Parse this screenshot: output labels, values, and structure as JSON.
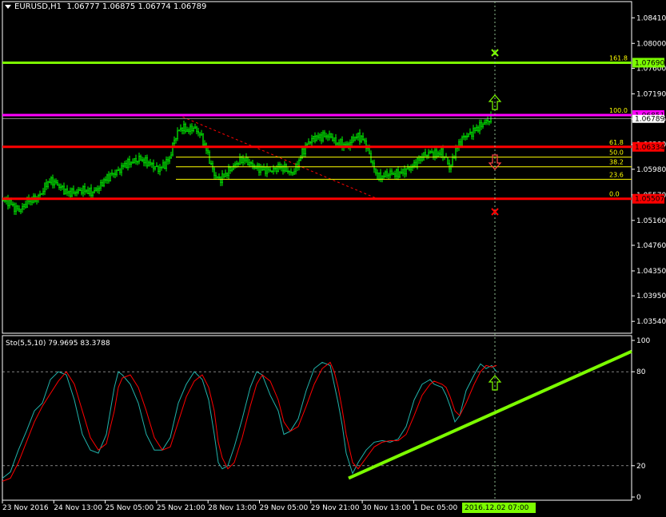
{
  "header": {
    "symbol": "EURUSD,H1",
    "ohlc": "1.06777 1.06875 1.06774 1.06789"
  },
  "colors": {
    "background": "#000000",
    "candle": "#00ff00",
    "fib": "#ffff00",
    "level_green": "#7cfc00",
    "level_magenta": "#ff00ff",
    "level_red": "#ff0000",
    "stoch_main": "#20b2aa",
    "stoch_signal": "#ff0000",
    "axis": "#ffffff"
  },
  "chart_data": [
    {
      "type": "candlestick",
      "title": "EURUSD,H1",
      "ohlc_label": "1.06777 1.06875 1.06774 1.06789",
      "ylim": [
        1.0335,
        1.0867
      ],
      "y_ticks": [
        "1.08410",
        "1.08000",
        "1.07600",
        "1.07190",
        "1.06785",
        "1.06380",
        "1.05980",
        "1.05570",
        "1.05160",
        "1.04760",
        "1.04350",
        "1.03950",
        "1.03540"
      ],
      "x_ticks": [
        "23 Nov 2016",
        "24 Nov 13:00",
        "25 Nov 05:00",
        "25 Nov 21:00",
        "28 Nov 13:00",
        "29 Nov 05:00",
        "29 Nov 21:00",
        "30 Nov 13:00",
        "1 Dec 05:00"
      ],
      "cursor_time": "2016.12.02 07:00",
      "price_path": [
        [
          0,
          1.0552
        ],
        [
          5,
          1.0548
        ],
        [
          12,
          1.0545
        ],
        [
          18,
          1.0536
        ],
        [
          25,
          1.0532
        ],
        [
          35,
          1.0548
        ],
        [
          45,
          1.055
        ],
        [
          52,
          1.056
        ],
        [
          58,
          1.0575
        ],
        [
          65,
          1.058
        ],
        [
          75,
          1.057
        ],
        [
          85,
          1.056
        ],
        [
          95,
          1.0562
        ],
        [
          105,
          1.0565
        ],
        [
          115,
          1.056
        ],
        [
          125,
          1.057
        ],
        [
          130,
          1.058
        ],
        [
          140,
          1.059
        ],
        [
          148,
          1.0595
        ],
        [
          155,
          1.0605
        ],
        [
          165,
          1.061
        ],
        [
          175,
          1.0615
        ],
        [
          182,
          1.061
        ],
        [
          190,
          1.0605
        ],
        [
          198,
          1.0598
        ],
        [
          205,
          1.0605
        ],
        [
          212,
          1.0615
        ],
        [
          218,
          1.0645
        ],
        [
          223,
          1.066
        ],
        [
          228,
          1.0665
        ],
        [
          235,
          1.066
        ],
        [
          242,
          1.0665
        ],
        [
          250,
          1.0655
        ],
        [
          255,
          1.064
        ],
        [
          260,
          1.0622
        ],
        [
          265,
          1.06
        ],
        [
          270,
          1.0585
        ],
        [
          275,
          1.0582
        ],
        [
          282,
          1.059
        ],
        [
          290,
          1.06
        ],
        [
          298,
          1.061
        ],
        [
          305,
          1.0615
        ],
        [
          312,
          1.0608
        ],
        [
          320,
          1.06
        ],
        [
          330,
          1.0598
        ],
        [
          340,
          1.0596
        ],
        [
          350,
          1.0602
        ],
        [
          358,
          1.0598
        ],
        [
          365,
          1.059
        ],
        [
          372,
          1.0605
        ],
        [
          378,
          1.0625
        ],
        [
          385,
          1.064
        ],
        [
          392,
          1.0648
        ],
        [
          400,
          1.065
        ],
        [
          408,
          1.0652
        ],
        [
          415,
          1.065
        ],
        [
          420,
          1.064
        ],
        [
          428,
          1.0638
        ],
        [
          435,
          1.0635
        ],
        [
          440,
          1.0645
        ],
        [
          447,
          1.0652
        ],
        [
          455,
          1.0645
        ],
        [
          460,
          1.063
        ],
        [
          465,
          1.061
        ],
        [
          470,
          1.059
        ],
        [
          475,
          1.0585
        ],
        [
          480,
          1.0588
        ],
        [
          488,
          1.0592
        ],
        [
          495,
          1.059
        ],
        [
          502,
          1.0593
        ],
        [
          510,
          1.0598
        ],
        [
          518,
          1.0605
        ],
        [
          525,
          1.0615
        ],
        [
          530,
          1.062
        ],
        [
          538,
          1.0625
        ],
        [
          545,
          1.0622
        ],
        [
          552,
          1.0625
        ],
        [
          558,
          1.0615
        ],
        [
          562,
          1.06
        ],
        [
          566,
          1.0612
        ],
        [
          570,
          1.063
        ],
        [
          575,
          1.064
        ],
        [
          580,
          1.065
        ],
        [
          588,
          1.0655
        ],
        [
          595,
          1.0662
        ],
        [
          603,
          1.067
        ],
        [
          610,
          1.0676
        ],
        [
          615,
          1.068
        ]
      ],
      "levels": [
        {
          "label": "161.8",
          "price": 1.0769,
          "box": "1.07690",
          "color": "#7cfc00",
          "axis_box": true
        },
        {
          "label": "100.0",
          "price": 1.0685,
          "box": "1.06851",
          "color": "#ff00ff",
          "axis_box": true
        },
        {
          "label": "61.8",
          "price": 1.0634,
          "box": "1.06334",
          "color": "#ff0000",
          "axis_box": true
        },
        {
          "label": "50.0",
          "price": 1.06175,
          "color": "#ffff00"
        },
        {
          "label": "38.2",
          "price": 1.0602,
          "color": "#ffff00"
        },
        {
          "label": "23.6",
          "price": 1.0582,
          "color": "#ffff00"
        },
        {
          "label": "0.0",
          "price": 1.05507,
          "box": "1.05507",
          "color": "#ff0000",
          "axis_box": true
        }
      ],
      "current_price_box": "1.06789"
    },
    {
      "type": "line",
      "title": "Sto(5,5,10) 79.9695 83.3788",
      "ylim": [
        0,
        100
      ],
      "y_ticks": [
        100,
        80,
        20,
        0
      ],
      "series": [
        {
          "name": "main",
          "values": [
            [
              0,
              12
            ],
            [
              10,
              16
            ],
            [
              20,
              30
            ],
            [
              30,
              42
            ],
            [
              40,
              55
            ],
            [
              50,
              60
            ],
            [
              60,
              75
            ],
            [
              70,
              80
            ],
            [
              80,
              78
            ],
            [
              90,
              62
            ],
            [
              100,
              40
            ],
            [
              110,
              30
            ],
            [
              120,
              28
            ],
            [
              130,
              40
            ],
            [
              140,
              70
            ],
            [
              145,
              80
            ],
            [
              150,
              78
            ],
            [
              160,
              72
            ],
            [
              170,
              60
            ],
            [
              180,
              40
            ],
            [
              190,
              30
            ],
            [
              200,
              30
            ],
            [
              210,
              38
            ],
            [
              220,
              60
            ],
            [
              230,
              72
            ],
            [
              240,
              80
            ],
            [
              250,
              75
            ],
            [
              258,
              62
            ],
            [
              265,
              40
            ],
            [
              270,
              22
            ],
            [
              275,
              18
            ],
            [
              282,
              20
            ],
            [
              290,
              32
            ],
            [
              300,
              50
            ],
            [
              310,
              70
            ],
            [
              318,
              80
            ],
            [
              325,
              78
            ],
            [
              335,
              65
            ],
            [
              345,
              55
            ],
            [
              352,
              40
            ],
            [
              360,
              42
            ],
            [
              370,
              50
            ],
            [
              380,
              68
            ],
            [
              390,
              82
            ],
            [
              400,
              86
            ],
            [
              410,
              84
            ],
            [
              415,
              72
            ],
            [
              420,
              60
            ],
            [
              425,
              46
            ],
            [
              430,
              28
            ],
            [
              438,
              15
            ],
            [
              445,
              22
            ],
            [
              455,
              30
            ],
            [
              465,
              35
            ],
            [
              475,
              36
            ],
            [
              485,
              35
            ],
            [
              495,
              37
            ],
            [
              505,
              45
            ],
            [
              515,
              62
            ],
            [
              525,
              72
            ],
            [
              535,
              75
            ],
            [
              540,
              72
            ],
            [
              550,
              70
            ],
            [
              555,
              65
            ],
            [
              560,
              58
            ],
            [
              566,
              48
            ],
            [
              572,
              52
            ],
            [
              580,
              68
            ],
            [
              590,
              78
            ],
            [
              598,
              85
            ],
            [
              605,
              82
            ],
            [
              612,
              84
            ],
            [
              618,
              80
            ]
          ]
        },
        {
          "name": "signal",
          "values": [
            [
              0,
              10
            ],
            [
              10,
              12
            ],
            [
              20,
              22
            ],
            [
              30,
              35
            ],
            [
              40,
              48
            ],
            [
              50,
              58
            ],
            [
              60,
              66
            ],
            [
              70,
              74
            ],
            [
              80,
              80
            ],
            [
              90,
              72
            ],
            [
              100,
              55
            ],
            [
              110,
              38
            ],
            [
              120,
              30
            ],
            [
              130,
              34
            ],
            [
              140,
              55
            ],
            [
              145,
              70
            ],
            [
              150,
              76
            ],
            [
              160,
              78
            ],
            [
              170,
              70
            ],
            [
              180,
              55
            ],
            [
              190,
              38
            ],
            [
              200,
              30
            ],
            [
              210,
              32
            ],
            [
              220,
              48
            ],
            [
              230,
              64
            ],
            [
              240,
              74
            ],
            [
              250,
              78
            ],
            [
              258,
              70
            ],
            [
              265,
              55
            ],
            [
              270,
              35
            ],
            [
              275,
              25
            ],
            [
              282,
              18
            ],
            [
              290,
              22
            ],
            [
              300,
              38
            ],
            [
              310,
              58
            ],
            [
              318,
              72
            ],
            [
              325,
              78
            ],
            [
              335,
              74
            ],
            [
              345,
              62
            ],
            [
              352,
              48
            ],
            [
              360,
              42
            ],
            [
              370,
              45
            ],
            [
              380,
              58
            ],
            [
              390,
              72
            ],
            [
              400,
              82
            ],
            [
              410,
              86
            ],
            [
              415,
              80
            ],
            [
              420,
              70
            ],
            [
              425,
              56
            ],
            [
              430,
              40
            ],
            [
              438,
              22
            ],
            [
              445,
              18
            ],
            [
              455,
              25
            ],
            [
              465,
              32
            ],
            [
              475,
              35
            ],
            [
              485,
              36
            ],
            [
              495,
              36
            ],
            [
              505,
              40
            ],
            [
              515,
              52
            ],
            [
              525,
              65
            ],
            [
              535,
              72
            ],
            [
              540,
              74
            ],
            [
              550,
              72
            ],
            [
              555,
              70
            ],
            [
              560,
              64
            ],
            [
              566,
              55
            ],
            [
              572,
              52
            ],
            [
              580,
              60
            ],
            [
              590,
              72
            ],
            [
              598,
              80
            ],
            [
              605,
              84
            ],
            [
              612,
              83
            ],
            [
              618,
              84
            ]
          ]
        }
      ]
    }
  ]
}
